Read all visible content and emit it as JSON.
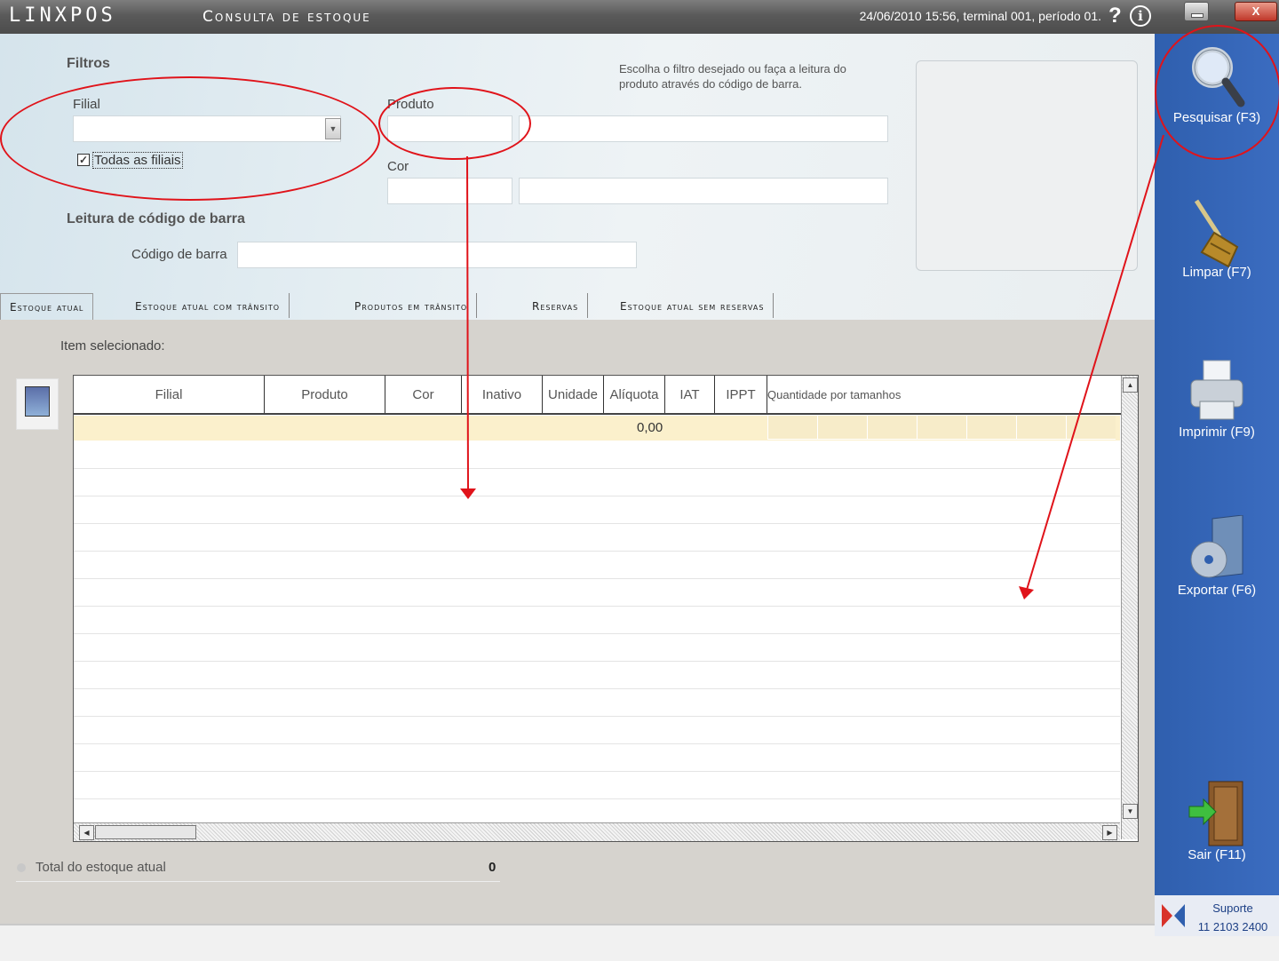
{
  "window": {
    "logo": "LINXPOS",
    "title": "Consulta de estoque",
    "status": "24/06/2010 15:56, terminal 001, período 01.",
    "help_glyph": "?",
    "info_glyph": "i",
    "close_glyph": "X"
  },
  "filters": {
    "section_title": "Filtros",
    "filial_label": "Filial",
    "filial_value": "",
    "all_branches_label": "Todas as filiais",
    "all_branches_checked": true,
    "product_label": "Produto",
    "color_label": "Cor",
    "hint": "Escolha o filtro desejado ou faça a leitura do produto através do código de barra.",
    "barcode_section_title": "Leitura de código de barra",
    "barcode_label": "Código de barra"
  },
  "tabs": [
    {
      "label": "Estoque atual",
      "active": true
    },
    {
      "label": "Estoque atual com trânsito",
      "active": false
    },
    {
      "label": "Produtos em trânsito",
      "active": false
    },
    {
      "label": "Reservas",
      "active": false
    },
    {
      "label": "Estoque atual sem reservas",
      "active": false
    }
  ],
  "grid": {
    "selected_item_label": "Item selecionado:",
    "columns": [
      "Filial",
      "Produto",
      "Cor",
      "Inativo",
      "Unidade",
      "Alíquota",
      "IAT",
      "IPPT",
      "Quantidade por tamanhos"
    ],
    "first_row_value": "0,00"
  },
  "totals": {
    "label": "Total do estoque atual",
    "value": "0"
  },
  "sidebar": {
    "buttons": [
      {
        "label": "Pesquisar (F3)",
        "icon": "magnifier-icon"
      },
      {
        "label": "Limpar (F7)",
        "icon": "broom-icon"
      },
      {
        "label": "Imprimir (F9)",
        "icon": "printer-icon"
      },
      {
        "label": "Exportar (F6)",
        "icon": "export-disc-icon"
      },
      {
        "label": "Sair (F11)",
        "icon": "exit-door-icon"
      }
    ],
    "support_label": "Suporte",
    "support_phone": "11 2103 2400"
  },
  "colors": {
    "sidebar": "#3464b6",
    "annotation": "#e0131a",
    "selected_row": "#fbf0cc"
  }
}
